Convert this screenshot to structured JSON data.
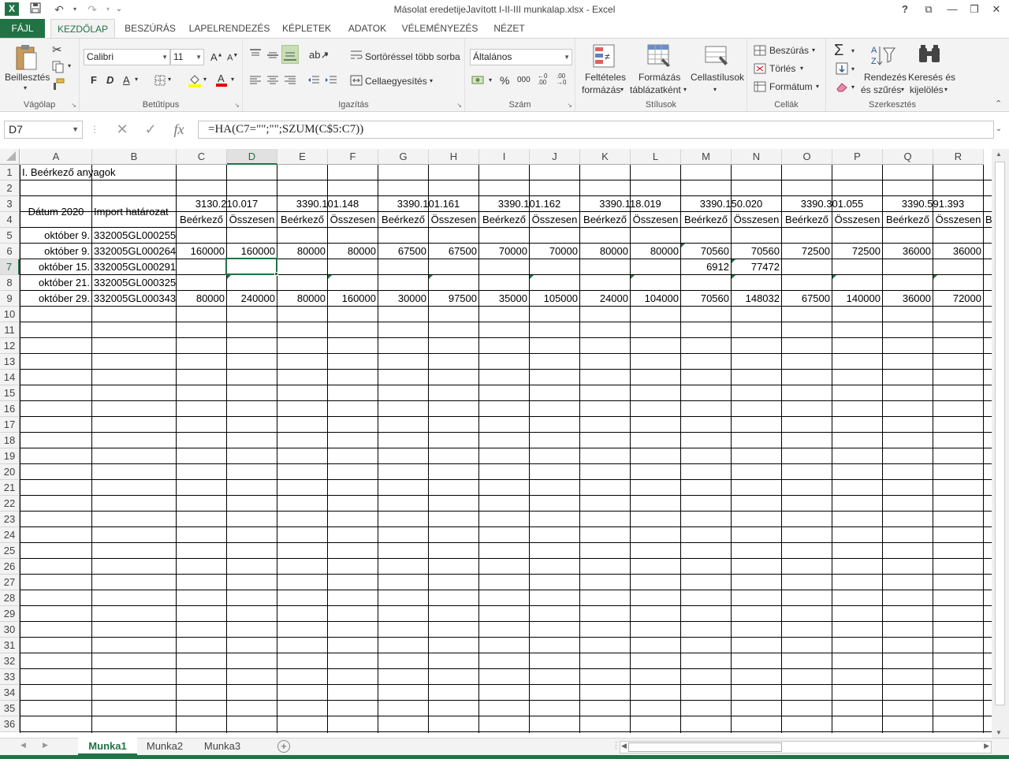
{
  "app": {
    "title": "Másolat eredetijeJavított I-II-III munkalap.xlsx - Excel",
    "logo": "X",
    "accent": "#217346"
  },
  "window_controls": {
    "help": "?",
    "ribbon_options": "⧉",
    "minimize": "—",
    "restore": "❐",
    "close": "✕"
  },
  "ribbon_tabs": [
    "FÁJL",
    "KEZDŐLAP",
    "BESZÚRÁS",
    "LAPELRENDEZÉS",
    "KÉPLETEK",
    "ADATOK",
    "VÉLEMÉNYEZÉS",
    "NÉZET"
  ],
  "active_tab": "KEZDŐLAP",
  "ribbon": {
    "clipboard": {
      "label": "Vágólap",
      "paste": "Beillesztés"
    },
    "font": {
      "label": "Betűtípus",
      "font_name": "Calibri",
      "font_size": "11",
      "bold": "F",
      "italic": "D",
      "underline": "A"
    },
    "alignment": {
      "label": "Igazítás",
      "wrap": "Sortöréssel több sorba",
      "merge": "Cellaegyesítés"
    },
    "number": {
      "label": "Szám",
      "format": "Általános",
      "percent": "%",
      "thousands": "000"
    },
    "styles": {
      "label": "Stílusok",
      "conditional": [
        "Feltételes",
        "formázás"
      ],
      "as_table": [
        "Formázás",
        "táblázatként"
      ],
      "cell_styles": "Cellastílusok"
    },
    "cells": {
      "label": "Cellák",
      "insert": "Beszúrás",
      "delete": "Törlés",
      "format": "Formátum"
    },
    "editing": {
      "label": "Szerkesztés",
      "sort": [
        "Rendezés",
        "és szűrés"
      ],
      "find": [
        "Keresés és",
        "kijelölés"
      ]
    }
  },
  "formula_bar": {
    "name_box": "D7",
    "formula": "=HA(C7=\"\";\"\";SZUM(C$5:C7))",
    "fx": "fx"
  },
  "columns": [
    "A",
    "B",
    "C",
    "D",
    "E",
    "F",
    "G",
    "H",
    "I",
    "J",
    "K",
    "L",
    "M",
    "N",
    "O",
    "P",
    "Q",
    "R"
  ],
  "selected_column": "D",
  "selected_row": 7,
  "rows": [
    "1",
    "2",
    "3",
    "4",
    "5",
    "6",
    "7",
    "8",
    "9",
    "10",
    "11",
    "12",
    "13",
    "14",
    "15",
    "16",
    "17",
    "18",
    "19",
    "20",
    "21",
    "22",
    "23",
    "24",
    "25",
    "26",
    "27",
    "28",
    "29",
    "30",
    "31",
    "32",
    "33",
    "34",
    "35",
    "36"
  ],
  "sheet": {
    "a1": "I. Beérkező anyagok",
    "header_date": "Dátum 2020",
    "header_import": "Import határozat",
    "accounts": [
      "3130.210.017",
      "3390.101.148",
      "3390.101.161",
      "3390.101.162",
      "3390.118.019",
      "3390.150.020",
      "3390.301.055",
      "3390.591.393"
    ],
    "sub_in": "Beérkező",
    "sub_total": "Összesen",
    "sub_overflow": "B",
    "dates": [
      "október 9.",
      "október 9.",
      "október 15.",
      "október 21.",
      "október 29."
    ],
    "imports": [
      "332005GL000255",
      "332005GL000264",
      "332005GL000291",
      "332005GL000325",
      "332005GL000343"
    ],
    "row6": [
      "160000",
      "160000",
      "80000",
      "80000",
      "67500",
      "67500",
      "70000",
      "70000",
      "80000",
      "80000",
      "70560",
      "70560",
      "72500",
      "72500",
      "36000",
      "36000"
    ],
    "row7": [
      "",
      "",
      "",
      "",
      "",
      "",
      "",
      "",
      "",
      "",
      "6912",
      "77472",
      "",
      "",
      "",
      ""
    ],
    "row9": [
      "80000",
      "240000",
      "80000",
      "160000",
      "30000",
      "97500",
      "35000",
      "105000",
      "24000",
      "104000",
      "70560",
      "148032",
      "67500",
      "140000",
      "36000",
      "72000"
    ]
  },
  "sheet_tabs": [
    "Munka1",
    "Munka2",
    "Munka3"
  ],
  "active_sheet": "Munka1",
  "icons": [
    "excel-logo-icon",
    "save-icon",
    "undo-icon",
    "redo-icon",
    "paste-icon",
    "cut-icon",
    "copy-icon",
    "format-painter-icon",
    "sum-icon",
    "sort-filter-icon",
    "find-icon",
    "add-sheet-icon"
  ]
}
